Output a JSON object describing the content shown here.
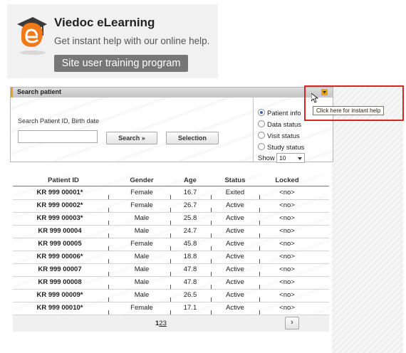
{
  "banner": {
    "title": "Viedoc eLearning",
    "subtitle": "Get instant help with our online help.",
    "training_button": "Site user training program"
  },
  "search_panel": {
    "title": "Search patient",
    "search_label": "Search Patient ID, Birth date",
    "search_value": "",
    "search_button": "Search  »",
    "selection_button": "Selection",
    "options": [
      {
        "label": "Patient info",
        "selected": true
      },
      {
        "label": "Data status",
        "selected": false
      },
      {
        "label": "Visit status",
        "selected": false
      },
      {
        "label": "Study status",
        "selected": false
      }
    ],
    "show_label": "Show",
    "show_value": "10",
    "help_tooltip": "Click here for instant help"
  },
  "table": {
    "columns": [
      "Patient ID",
      "Gender",
      "Age",
      "Status",
      "Locked"
    ],
    "rows": [
      [
        "KR 999 00001*",
        "Female",
        "16.7",
        "Exited",
        "<no>"
      ],
      [
        "KR 999 00002*",
        "Female",
        "26.7",
        "Active",
        "<no>"
      ],
      [
        "KR 999 00003*",
        "Male",
        "25.8",
        "Active",
        "<no>"
      ],
      [
        "KR 999 00004",
        "Male",
        "24.7",
        "Active",
        "<no>"
      ],
      [
        "KR 999 00005",
        "Female",
        "45.8",
        "Active",
        "<no>"
      ],
      [
        "KR 999 00006*",
        "Male",
        "18.8",
        "Active",
        "<no>"
      ],
      [
        "KR 999 00007",
        "Male",
        "47.8",
        "Active",
        "<no>"
      ],
      [
        "KR 999 00008",
        "Male",
        "47.8",
        "Active",
        "<no>"
      ],
      [
        "KR 999 00009*",
        "Male",
        "26.5",
        "Active",
        "<no>"
      ],
      [
        "KR 999 00010*",
        "Female",
        "17.1",
        "Active",
        "<no>"
      ]
    ],
    "pages": [
      "1",
      "2",
      "3"
    ],
    "current_page": "1",
    "next_label": "›"
  },
  "colors": {
    "header_accent": "#e7a21a",
    "highlight_border": "#d6262b",
    "training_button": "#777777",
    "radio_selected": "#2a62c9"
  },
  "icons": [
    "elearning-logo-icon",
    "help-icon",
    "mouse-cursor-icon",
    "chevron-down-icon"
  ]
}
